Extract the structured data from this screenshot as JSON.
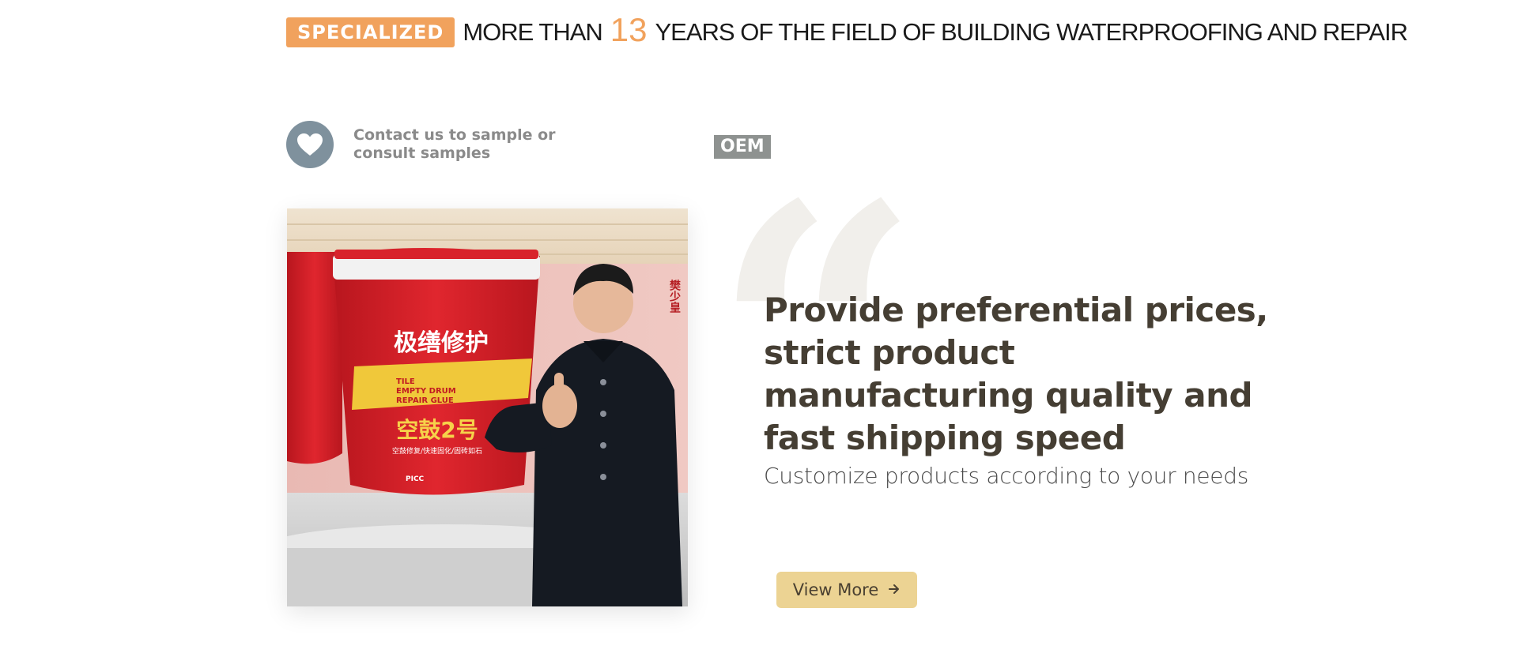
{
  "tagline": {
    "badge": "SPECIALIZED",
    "prefix": "MORE THAN",
    "number": "13",
    "suffix": "YEARS OF THE FIELD OF BUILDING WATERPROOFING AND REPAIR"
  },
  "contact": {
    "icon": "heart-icon",
    "text": "Contact us to sample or consult samples"
  },
  "oem_badge": "OEM",
  "product_image": {
    "bucket_title": "极缮修护",
    "bucket_label_lines": [
      "TILE",
      "EMPTY DRUM",
      "REPAIR GLUE"
    ],
    "bucket_product_name": "空鼓2号",
    "bucket_tagline": "空鼓修复/快速固化/固砖如石",
    "bucket_brand": "PICC",
    "side_text": "樊少皇"
  },
  "feature": {
    "quote_icon": "quote-icon",
    "headline": "Provide preferential prices, strict product manufacturing quality and fast shipping speed",
    "subtitle": "Customize products according to your needs",
    "button_label": "View More",
    "button_icon": "arrow-right-icon"
  },
  "colors": {
    "accent_orange": "#f1a25d",
    "button_gold": "#ecd393",
    "heading_brown": "#453e33",
    "bucket_red": "#d9242b"
  }
}
